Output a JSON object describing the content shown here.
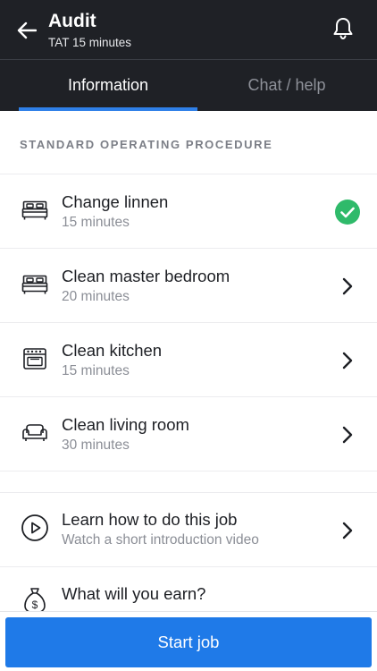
{
  "header": {
    "title": "Audit",
    "subtitle": "TAT 15 minutes",
    "back_icon": "arrow-left-icon",
    "notification_icon": "bell-icon"
  },
  "tabs": [
    {
      "label": "Information",
      "active": true
    },
    {
      "label": "Chat / help",
      "active": false
    }
  ],
  "section": {
    "title": "STANDARD OPERATING PROCEDURE"
  },
  "sop_items": [
    {
      "title": "Change linnen",
      "duration": "15 minutes",
      "icon": "bed-icon",
      "status": "completed"
    },
    {
      "title": "Clean master bedroom",
      "duration": "20 minutes",
      "icon": "bed-icon",
      "status": "pending"
    },
    {
      "title": "Clean kitchen",
      "duration": "15 minutes",
      "icon": "oven-icon",
      "status": "pending"
    },
    {
      "title": "Clean living room",
      "duration": "30 minutes",
      "icon": "sofa-icon",
      "status": "pending"
    }
  ],
  "learn": {
    "title": "Learn how to do this job",
    "subtitle": "Watch a short introduction video",
    "icon": "play-circle-icon"
  },
  "earn": {
    "title": "What will you earn?",
    "icon": "money-bag-icon"
  },
  "footer": {
    "start_label": "Start job"
  },
  "colors": {
    "header_bg": "#1f2126",
    "accent": "#2f80e8",
    "button": "#1f7ae8",
    "success": "#2fba6a"
  }
}
